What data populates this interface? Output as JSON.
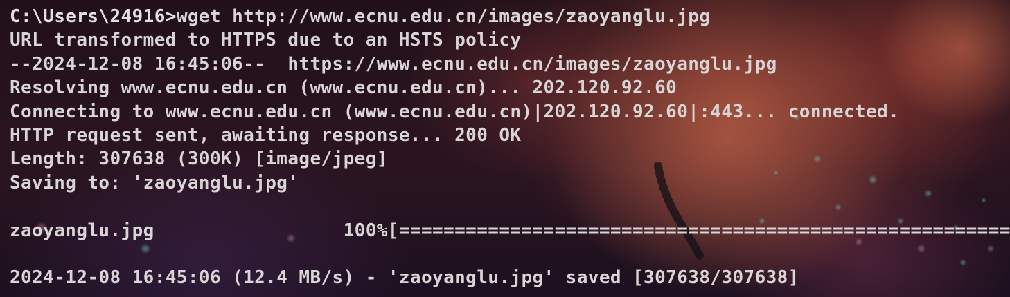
{
  "terminal": {
    "prompt": "C:\\Users\\24916>",
    "command": "wget http://www.ecnu.edu.cn/images/zaoyanglu.jpg",
    "lines": [
      "URL transformed to HTTPS due to an HSTS policy",
      "--2024-12-08 16:45:06--  https://www.ecnu.edu.cn/images/zaoyanglu.jpg",
      "Resolving www.ecnu.edu.cn (www.ecnu.edu.cn)... 202.120.92.60",
      "Connecting to www.ecnu.edu.cn (www.ecnu.edu.cn)|202.120.92.60|:443... connected.",
      "HTTP request sent, awaiting response... 200 OK",
      "Length: 307638 (300K) [image/jpeg]",
      "Saving to: 'zaoyanglu.jpg'",
      "",
      "zaoyanglu.jpg                 100%[=======================================================",
      "",
      "2024-12-08 16:45:06 (12.4 MB/s) - 'zaoyanglu.jpg' saved [307638/307638]"
    ]
  },
  "download": {
    "file_name": "zaoyanglu.jpg",
    "progress_percent": 100,
    "bytes_total": 307638,
    "bytes_received": 307638,
    "speed": "12.4 MB/s"
  },
  "colors": {
    "text": "#d9d4d6",
    "background": "#211019",
    "accent_glow": "#be503c"
  }
}
